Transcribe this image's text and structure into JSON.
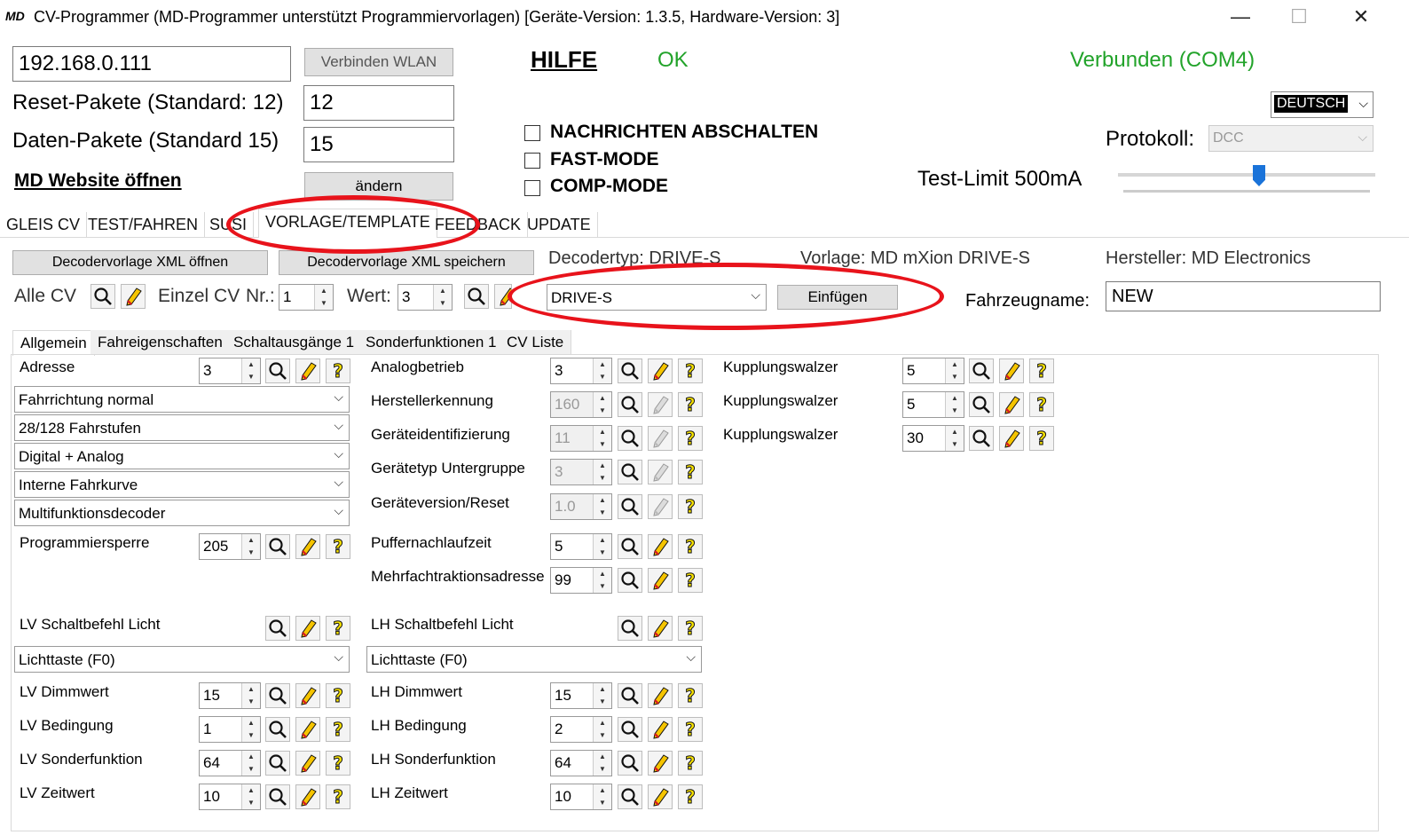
{
  "window": {
    "app_icon": "MD",
    "title": "CV-Programmer (MD-Programmer unterstützt Programmiervorlagen)   [Geräte-Version: 1.3.5, Hardware-Version: 3]",
    "minimize": "—",
    "maximize": "☐",
    "close": "✕"
  },
  "top": {
    "ip_value": "192.168.0.111",
    "connect_wlan": "Verbinden WLAN",
    "hilfe": "HILFE",
    "ok": "OK",
    "status": "Verbunden (COM4)",
    "reset_label": "Reset-Pakete (Standard: 12)",
    "reset_value": "12",
    "data_label": "Daten-Pakete (Standard 15)",
    "data_value": "15",
    "website_link": "MD Website öffnen",
    "aendern": "ändern",
    "chk_nachrichten": "NACHRICHTEN ABSCHALTEN",
    "chk_fast": "FAST-MODE",
    "chk_comp": "COMP-MODE",
    "language": "DEUTSCH",
    "protokoll_label": "Protokoll:",
    "protokoll_value": "DCC",
    "testlimit_label": "Test-Limit 500mA",
    "slider_level": 0.55
  },
  "main_tabs": [
    "GLEIS CV",
    "TEST/FAHREN",
    "SUSI",
    "VORLAGE/TEMPLATE",
    "FEEDBACK",
    "UPDATE"
  ],
  "vorlage": {
    "open_xml": "Decodervorlage XML öffnen",
    "save_xml": "Decodervorlage XML speichern",
    "decodertyp": "Decodertyp: DRIVE-S",
    "vorlage": "Vorlage: MD mXion DRIVE-S",
    "hersteller": "Hersteller: MD Electronics",
    "alle_cv": "Alle CV",
    "einzel_cv": "Einzel CV",
    "nr_label": "Nr.:",
    "nr_value": "1",
    "wert_label": "Wert:",
    "wert_value": "3",
    "decoder_select": "DRIVE-S",
    "einfuegen": "Einfügen",
    "fahrzeugname_label": "Fahrzeugname:",
    "fahrzeugname_value": "NEW"
  },
  "sub_tabs": [
    "Allgemein",
    "Fahreigenschaften",
    "Schaltausgänge 1",
    "Sonderfunktionen 1",
    "CV Liste"
  ],
  "col1": {
    "adresse_label": "Adresse",
    "adresse_value": "3",
    "combos": [
      "Fahrrichtung normal",
      "28/128 Fahrstufen",
      "Digital + Analog",
      "Interne Fahrkurve",
      "Multifunktionsdecoder"
    ],
    "programmiersperre_label": "Programmiersperre",
    "programmiersperre_value": "205"
  },
  "col2": [
    {
      "label": "Analogbetrieb",
      "value": "3",
      "disabled": false
    },
    {
      "label": "Herstellerkennung",
      "value": "160",
      "disabled": true
    },
    {
      "label": "Geräteidentifizierung",
      "value": "11",
      "disabled": true
    },
    {
      "label": "Gerätetyp Untergruppe",
      "value": "3",
      "disabled": true
    },
    {
      "label": "Geräteversion/Reset",
      "value": "1.0",
      "disabled": true
    },
    {
      "label": "Puffernachlaufzeit",
      "value": "5",
      "disabled": false
    },
    {
      "label": "Mehrfachtraktionsadresse",
      "value": "99",
      "disabled": false
    }
  ],
  "col3": [
    {
      "label": "Kupplungswalzer",
      "value": "5"
    },
    {
      "label": "Kupplungswalzer",
      "value": "5"
    },
    {
      "label": "Kupplungswalzer",
      "value": "30"
    }
  ],
  "lv": {
    "schaltbefehl_label": "LV Schaltbefehl Licht",
    "schaltbefehl_value": "Lichttaste (F0)",
    "rows": [
      {
        "label": "LV Dimmwert",
        "value": "15"
      },
      {
        "label": "LV Bedingung",
        "value": "1"
      },
      {
        "label": "LV Sonderfunktion",
        "value": "64"
      },
      {
        "label": "LV Zeitwert",
        "value": "10"
      }
    ]
  },
  "lh": {
    "schaltbefehl_label": "LH Schaltbefehl Licht",
    "schaltbefehl_value": "Lichttaste (F0)",
    "rows": [
      {
        "label": "LH Dimmwert",
        "value": "15"
      },
      {
        "label": "LH Bedingung",
        "value": "2"
      },
      {
        "label": "LH Sonderfunktion",
        "value": "64"
      },
      {
        "label": "LH Zeitwert",
        "value": "10"
      }
    ]
  },
  "icons": {
    "read": "magnifier-icon",
    "write": "pencil-icon",
    "help": "question-icon"
  },
  "colors": {
    "ok_green": "#22a32a",
    "annotation_red": "#e8131b",
    "slider_blue": "#1a73d9"
  }
}
